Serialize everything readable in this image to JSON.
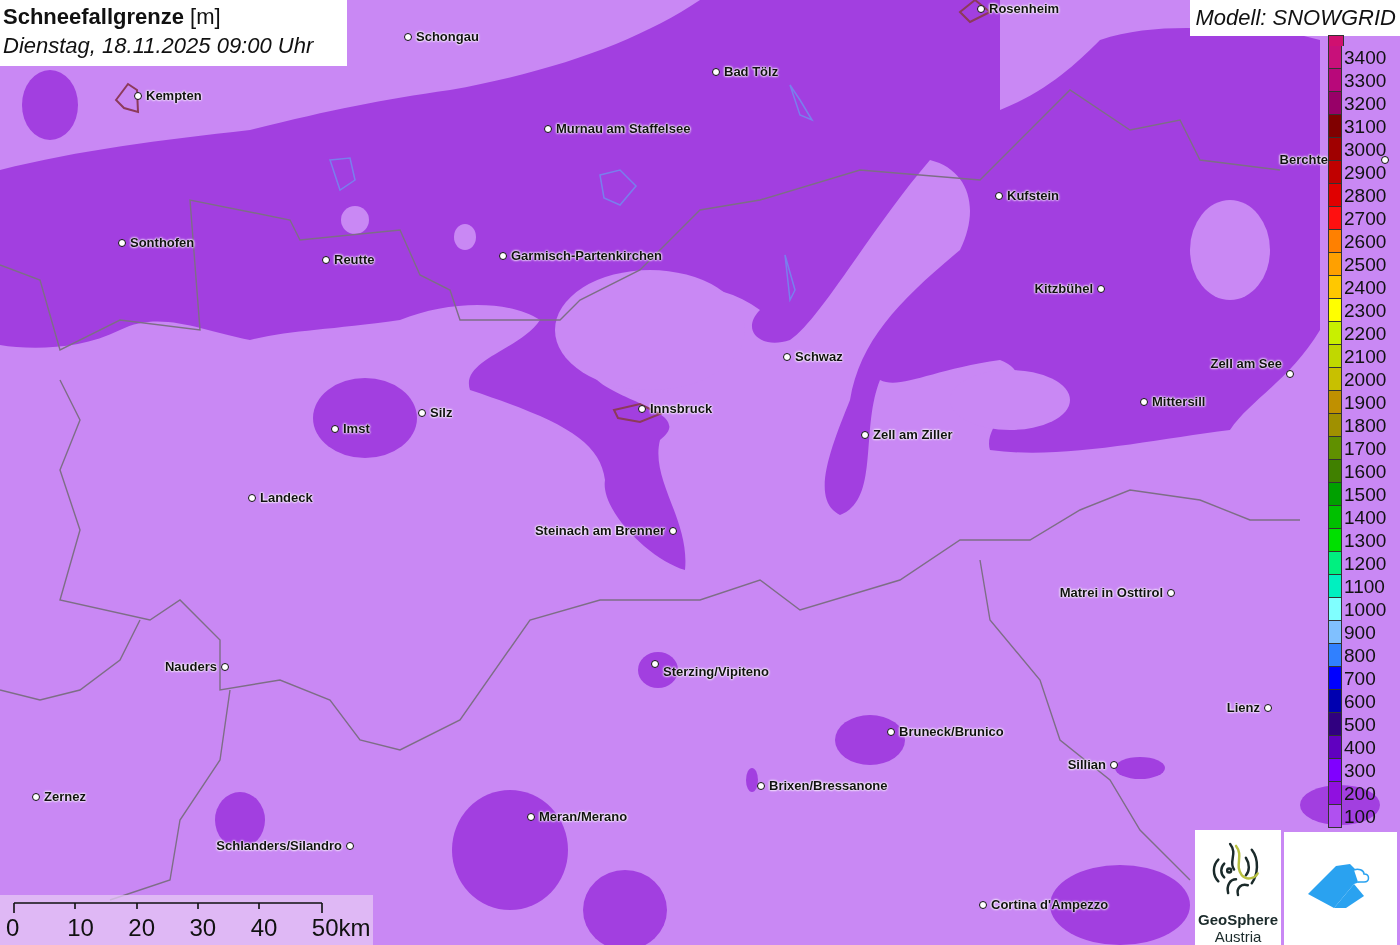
{
  "title": {
    "text": "Schneefallgrenze",
    "unit": "[m]",
    "date": "Dienstag, 18.11.2025 09:00 Uhr"
  },
  "model_label": "Modell: SNOWGRID",
  "places": [
    {
      "name": "Schongau"
    },
    {
      "name": "Rosenheim"
    },
    {
      "name": "Kempten"
    },
    {
      "name": "Bad Tölz"
    },
    {
      "name": "Murnau am Staffelsee"
    },
    {
      "name": "Kufstein"
    },
    {
      "name": "Sonthofen"
    },
    {
      "name": "Reutte"
    },
    {
      "name": "Garmisch-Partenkirchen"
    },
    {
      "name": "Kitzbühel"
    },
    {
      "name": "Schwaz"
    },
    {
      "name": "Zell am See"
    },
    {
      "name": "Silz"
    },
    {
      "name": "Imst"
    },
    {
      "name": "Innsbruck"
    },
    {
      "name": "Mittersill"
    },
    {
      "name": "Zell am Ziller"
    },
    {
      "name": "Landeck"
    },
    {
      "name": "Steinach am Brenner"
    },
    {
      "name": "Matrei in Osttirol"
    },
    {
      "name": "Nauders"
    },
    {
      "name": "Sterzing/Vipiteno"
    },
    {
      "name": "Lienz"
    },
    {
      "name": "Bruneck/Brunico"
    },
    {
      "name": "Sillian"
    },
    {
      "name": "Zernez"
    },
    {
      "name": "Brixen/Bressanone"
    },
    {
      "name": "Meran/Merano"
    },
    {
      "name": "Schlanders/Silandro"
    },
    {
      "name": "Cortina d'Ampezzo"
    },
    {
      "name": "Berchte"
    }
  ],
  "legend": [
    {
      "label": "3400",
      "color": "#c8107a"
    },
    {
      "label": "3300",
      "color": "#b8087a"
    },
    {
      "label": "3200",
      "color": "#980068"
    },
    {
      "label": "3100",
      "color": "#800000"
    },
    {
      "label": "3000",
      "color": "#a00000"
    },
    {
      "label": "2900",
      "color": "#c00000"
    },
    {
      "label": "2800",
      "color": "#e00000"
    },
    {
      "label": "2700",
      "color": "#ff1010"
    },
    {
      "label": "2600",
      "color": "#ff8000"
    },
    {
      "label": "2500",
      "color": "#ffa000"
    },
    {
      "label": "2400",
      "color": "#ffc800"
    },
    {
      "label": "2300",
      "color": "#ffff00"
    },
    {
      "label": "2200",
      "color": "#c8f000"
    },
    {
      "label": "2100",
      "color": "#c0d800"
    },
    {
      "label": "2000",
      "color": "#c8c000"
    },
    {
      "label": "1900",
      "color": "#c09000"
    },
    {
      "label": "1800",
      "color": "#a09000"
    },
    {
      "label": "1700",
      "color": "#609000"
    },
    {
      "label": "1600",
      "color": "#408000"
    },
    {
      "label": "1500",
      "color": "#00a000"
    },
    {
      "label": "1400",
      "color": "#00c000"
    },
    {
      "label": "1300",
      "color": "#00e000"
    },
    {
      "label": "1200",
      "color": "#00f080"
    },
    {
      "label": "1100",
      "color": "#00f0c0"
    },
    {
      "label": "1000",
      "color": "#80ffff"
    },
    {
      "label": "900",
      "color": "#80c0ff"
    },
    {
      "label": "800",
      "color": "#3080ff"
    },
    {
      "label": "700",
      "color": "#0000ff"
    },
    {
      "label": "600",
      "color": "#0000b0"
    },
    {
      "label": "500",
      "color": "#300080"
    },
    {
      "label": "400",
      "color": "#6000c0"
    },
    {
      "label": "300",
      "color": "#8000ff"
    },
    {
      "label": "200",
      "color": "#9010e0"
    },
    {
      "label": "100",
      "color": "#b050f0"
    }
  ],
  "scale_bar": {
    "ticks": [
      "0",
      "10",
      "20",
      "30",
      "40",
      "50km"
    ]
  },
  "logo": {
    "name": "GeoSphere",
    "subtitle": "Austria"
  }
}
